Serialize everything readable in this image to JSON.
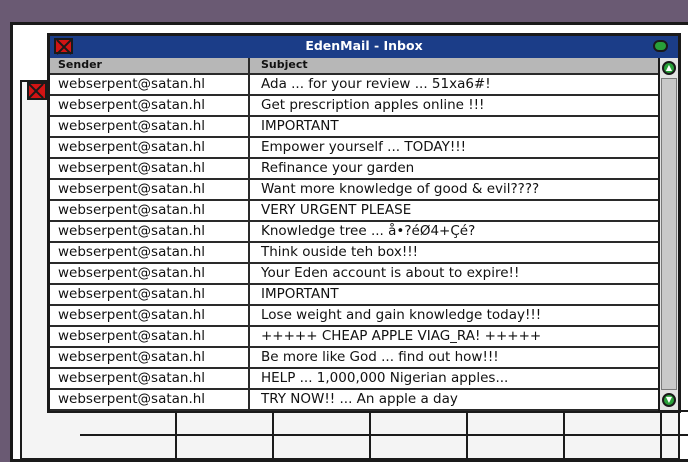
{
  "window": {
    "title": "EdenMail - Inbox"
  },
  "columns": {
    "sender": "Sender",
    "subject": "Subject"
  },
  "emails": [
    {
      "sender": "webserpent@satan.hl",
      "subject": "Ada ... for your review ... 51xa6#!"
    },
    {
      "sender": "webserpent@satan.hl",
      "subject": "Get prescription apples online !!!"
    },
    {
      "sender": "webserpent@satan.hl",
      "subject": "IMPORTANT"
    },
    {
      "sender": "webserpent@satan.hl",
      "subject": "Empower yourself ... TODAY!!!"
    },
    {
      "sender": "webserpent@satan.hl",
      "subject": "Refinance your garden"
    },
    {
      "sender": "webserpent@satan.hl",
      "subject": "Want more knowledge of good & evil????"
    },
    {
      "sender": "webserpent@satan.hl",
      "subject": "VERY URGENT PLEASE"
    },
    {
      "sender": "webserpent@satan.hl",
      "subject": "Knowledge tree ... å•?éØ4+Çé?"
    },
    {
      "sender": "webserpent@satan.hl",
      "subject": "Think ouside teh box!!!"
    },
    {
      "sender": "webserpent@satan.hl",
      "subject": "Your Eden account is about to expire!!"
    },
    {
      "sender": "webserpent@satan.hl",
      "subject": "IMPORTANT"
    },
    {
      "sender": "webserpent@satan.hl",
      "subject": "Lose weight and gain knowledge today!!!"
    },
    {
      "sender": "webserpent@satan.hl",
      "subject": "+++++ CHEAP APPLE VIAG_RA! +++++"
    },
    {
      "sender": "webserpent@satan.hl",
      "subject": "Be more like God ... find out how!!!"
    },
    {
      "sender": "webserpent@satan.hl",
      "subject": "HELP ... 1,000,000 Nigerian apples..."
    },
    {
      "sender": "webserpent@satan.hl",
      "subject": "TRY NOW!! ... An apple a day"
    }
  ],
  "icons": {
    "close": "close-icon",
    "zoom": "zoom-icon",
    "scroll_up": "up-arrow-icon",
    "scroll_down": "down-arrow-icon"
  },
  "colors": {
    "titlebar": "#1b3d88",
    "close_button": "#d11414",
    "zoom_button": "#28a039",
    "header": "#b7b7b7",
    "background": "#6a5a73"
  }
}
